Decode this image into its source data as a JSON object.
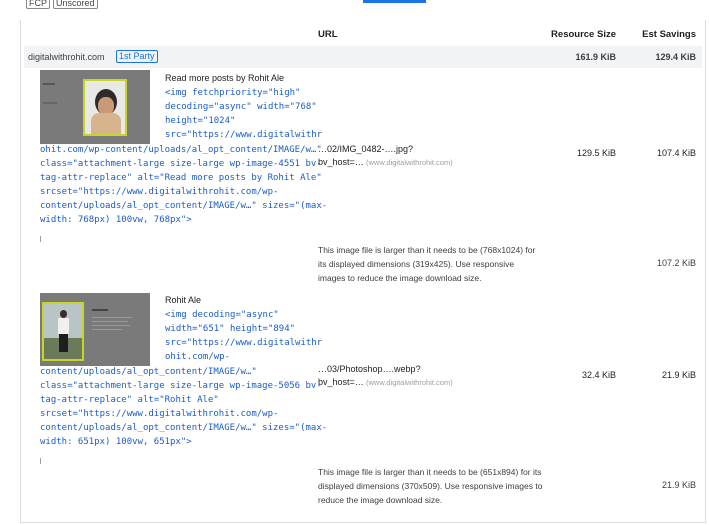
{
  "filters": [
    "FCP",
    "Unscored"
  ],
  "columns": {
    "url": "URL",
    "resource_size": "Resource Size",
    "est_savings": "Est Savings"
  },
  "group": {
    "domain": "digitalwithrohit.com",
    "party_badge": "1st Party",
    "resource_size": "161.9 KiB",
    "est_savings": "129.4 KiB"
  },
  "items": [
    {
      "label": "Read more posts by Rohit Ale",
      "code_lines": [
        "<img fetchpriority=\"high\"",
        "decoding=\"async\" width=\"768\"",
        "height=\"1024\"",
        "src=\"https://www.digitalwithr",
        "ohit.com/wp-content/uploads/al_opt_content/IMAGE/w…\"",
        "class=\"attachment-large size-large wp-image-4551 bv-",
        "tag-attr-replace\" alt=\"Read more posts by Rohit Ale\"",
        "srcset=\"https://www.digitalwithrohit.com/wp-",
        "content/uploads/al_opt_content/IMAGE/w…\" sizes=\"(max-",
        "width: 768px) 100vw, 768px\">"
      ],
      "url_short": "…02/IMG_0482-….jpg?",
      "url_query": "bv_host=…",
      "url_host": "(www.digitalwithrohit.com)",
      "resource_size": "129.5 KiB",
      "est_savings": "107.4 KiB",
      "subitem_text": "This image file is larger than it needs to be (768x1024) for its displayed dimensions (319x425). Use responsive images to reduce the image download size.",
      "subitem_savings": "107.2 KiB"
    },
    {
      "label": "Rohit Ale",
      "code_lines": [
        "<img decoding=\"async\"",
        "width=\"651\" height=\"894\"",
        "src=\"https://www.digitalwithr",
        "ohit.com/wp-",
        "content/uploads/al_opt_content/IMAGE/w…\"",
        "class=\"attachment-large size-large wp-image-5056 bv-",
        "tag-attr-replace\" alt=\"Rohit Ale\"",
        "srcset=\"https://www.digitalwithrohit.com/wp-",
        "content/uploads/al_opt_content/IMAGE/w…\" sizes=\"(max-",
        "width: 651px) 100vw, 651px\">"
      ],
      "url_short": "…03/Photoshop….webp?",
      "url_query": "bv_host=…",
      "url_host": "(www.digitalwithrohit.com)",
      "resource_size": "32.4 KiB",
      "est_savings": "21.9 KiB",
      "subitem_text": "This image file is larger than it needs to be (651x894) for its displayed dimensions (370x509). Use responsive images to reduce the image download size.",
      "subitem_savings": "21.9 KiB"
    }
  ],
  "colors": {
    "accent": "#1a73e8",
    "code": "#1a5cc8",
    "highlight": "#c8d42a",
    "group_bg": "#f1f3f4"
  }
}
